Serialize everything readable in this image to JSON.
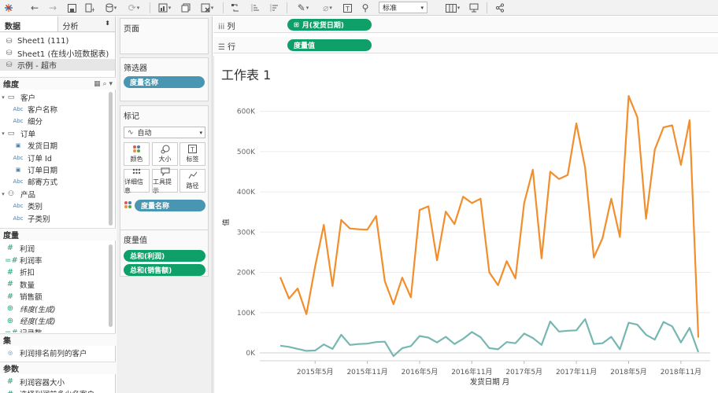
{
  "toolbar": {
    "fit_value": "标准",
    "icons": [
      "tableau-logo-icon",
      "back-icon",
      "forward-icon",
      "save-icon",
      "new-datasource-icon",
      "pause-updates-icon",
      "refresh-icon",
      "new-sheet-icon",
      "duplicate-icon",
      "clear-icon",
      "swap-icon",
      "sort-asc-icon",
      "sort-desc-icon",
      "highlight-icon",
      "group-icon",
      "label-icon",
      "pin-icon",
      "show-cards-icon",
      "presentation-icon",
      "share-icon"
    ]
  },
  "left_pane": {
    "tabs": {
      "data": "数据",
      "analysis": "分析"
    },
    "datasources": [
      {
        "label": "Sheet1 (111)",
        "selected": false
      },
      {
        "label": "Sheet1 (在线小班数据表)",
        "selected": false
      },
      {
        "label": "示例 - 超市",
        "selected": true
      }
    ],
    "dimensions_title": "维度",
    "dimensions": [
      {
        "label": "客户",
        "kind": "folder",
        "level": 0
      },
      {
        "label": "客户名称",
        "kind": "Abc",
        "level": 1
      },
      {
        "label": "细分",
        "kind": "Abc",
        "level": 1
      },
      {
        "label": "订单",
        "kind": "folder",
        "level": 0
      },
      {
        "label": "发货日期",
        "kind": "date",
        "level": 1
      },
      {
        "label": "订单 Id",
        "kind": "Abc",
        "level": 1
      },
      {
        "label": "订单日期",
        "kind": "date",
        "level": 1
      },
      {
        "label": "邮寄方式",
        "kind": "Abc",
        "level": 1
      },
      {
        "label": "产品",
        "kind": "hier",
        "level": 0
      },
      {
        "label": "类别",
        "kind": "Abc",
        "level": 1
      },
      {
        "label": "子类别",
        "kind": "Abc",
        "level": 1
      }
    ],
    "measures_title": "度量",
    "measures": [
      {
        "label": "利润",
        "kind": "#"
      },
      {
        "label": "利润率",
        "kind": "=#"
      },
      {
        "label": "折扣",
        "kind": "#"
      },
      {
        "label": "数量",
        "kind": "#"
      },
      {
        "label": "销售额",
        "kind": "#"
      },
      {
        "label": "纬度(生成)",
        "kind": "globe"
      },
      {
        "label": "经度(生成)",
        "kind": "globe"
      },
      {
        "label": "记录数",
        "kind": "=#"
      }
    ],
    "sets_title": "集",
    "sets": [
      {
        "label": "利润排名前列的客户"
      }
    ],
    "params_title": "参数",
    "params": [
      {
        "label": "利润容器大小"
      },
      {
        "label": "选择利润前多少名客户"
      }
    ]
  },
  "mid_pane": {
    "pages_title": "页面",
    "filters_title": "筛选器",
    "filter_pill": "度量名称",
    "marks_title": "标记",
    "mark_type": "自动",
    "mark_buttons": [
      "颜色",
      "大小",
      "标签",
      "详细信息",
      "工具提示",
      "路径"
    ],
    "marks_pill": "度量名称",
    "measure_values_title": "度量值",
    "measure_pills": [
      "总和(利润)",
      "总和(销售额)"
    ]
  },
  "shelves": {
    "columns_label": "列",
    "columns_pill": "月(发货日期)",
    "rows_label": "行",
    "rows_pill": "度量值"
  },
  "viz": {
    "sheet_title": "工作表 1"
  },
  "chart_data": {
    "type": "line",
    "title": "工作表 1",
    "xlabel": "发货日期 月",
    "ylabel": "值",
    "x_tick_labels": [
      "2015年5月",
      "2015年11月",
      "2016年5月",
      "2016年11月",
      "2017年5月",
      "2017年11月",
      "2018年5月",
      "2018年11月"
    ],
    "y_tick_labels": [
      "0K",
      "100K",
      "200K",
      "300K",
      "400K",
      "500K",
      "600K"
    ],
    "ylim": [
      0,
      650000
    ],
    "grid": true,
    "colors": {
      "销售额": "#f28e2c",
      "利润": "#76b7b2"
    },
    "x": [
      "2015-01",
      "2015-02",
      "2015-03",
      "2015-04",
      "2015-05",
      "2015-06",
      "2015-07",
      "2015-08",
      "2015-09",
      "2015-10",
      "2015-11",
      "2015-12",
      "2016-01",
      "2016-02",
      "2016-03",
      "2016-04",
      "2016-05",
      "2016-06",
      "2016-07",
      "2016-08",
      "2016-09",
      "2016-10",
      "2016-11",
      "2016-12",
      "2017-01",
      "2017-02",
      "2017-03",
      "2017-04",
      "2017-05",
      "2017-06",
      "2017-07",
      "2017-08",
      "2017-09",
      "2017-10",
      "2017-11",
      "2017-12",
      "2018-01",
      "2018-02",
      "2018-03",
      "2018-04",
      "2018-05",
      "2018-06",
      "2018-07",
      "2018-08",
      "2018-09",
      "2018-10",
      "2018-11",
      "2018-12",
      "2019-01"
    ],
    "series": [
      {
        "name": "销售额",
        "values": [
          188000,
          135000,
          160000,
          96000,
          215000,
          318000,
          166000,
          330000,
          309000,
          307000,
          306000,
          340000,
          178000,
          121000,
          187000,
          138000,
          355000,
          364000,
          230000,
          351000,
          320000,
          388000,
          372000,
          383000,
          200000,
          168000,
          228000,
          185000,
          372000,
          455000,
          235000,
          450000,
          432000,
          442000,
          570000,
          460000,
          237000,
          285000,
          383000,
          288000,
          638000,
          585000,
          333000,
          505000,
          560000,
          565000,
          467000,
          578000,
          38000
        ]
      },
      {
        "name": "利润",
        "values": [
          18000,
          15000,
          10000,
          5000,
          6000,
          21000,
          10000,
          45000,
          20000,
          22000,
          23000,
          27000,
          28000,
          -8000,
          12000,
          17000,
          42000,
          38000,
          26000,
          40000,
          22000,
          35000,
          52000,
          39000,
          12000,
          9000,
          27000,
          24000,
          48000,
          37000,
          20000,
          78000,
          53000,
          55000,
          56000,
          84000,
          22000,
          24000,
          40000,
          9000,
          75000,
          70000,
          45000,
          33000,
          77000,
          66000,
          26000,
          62000,
          2000
        ]
      }
    ]
  }
}
